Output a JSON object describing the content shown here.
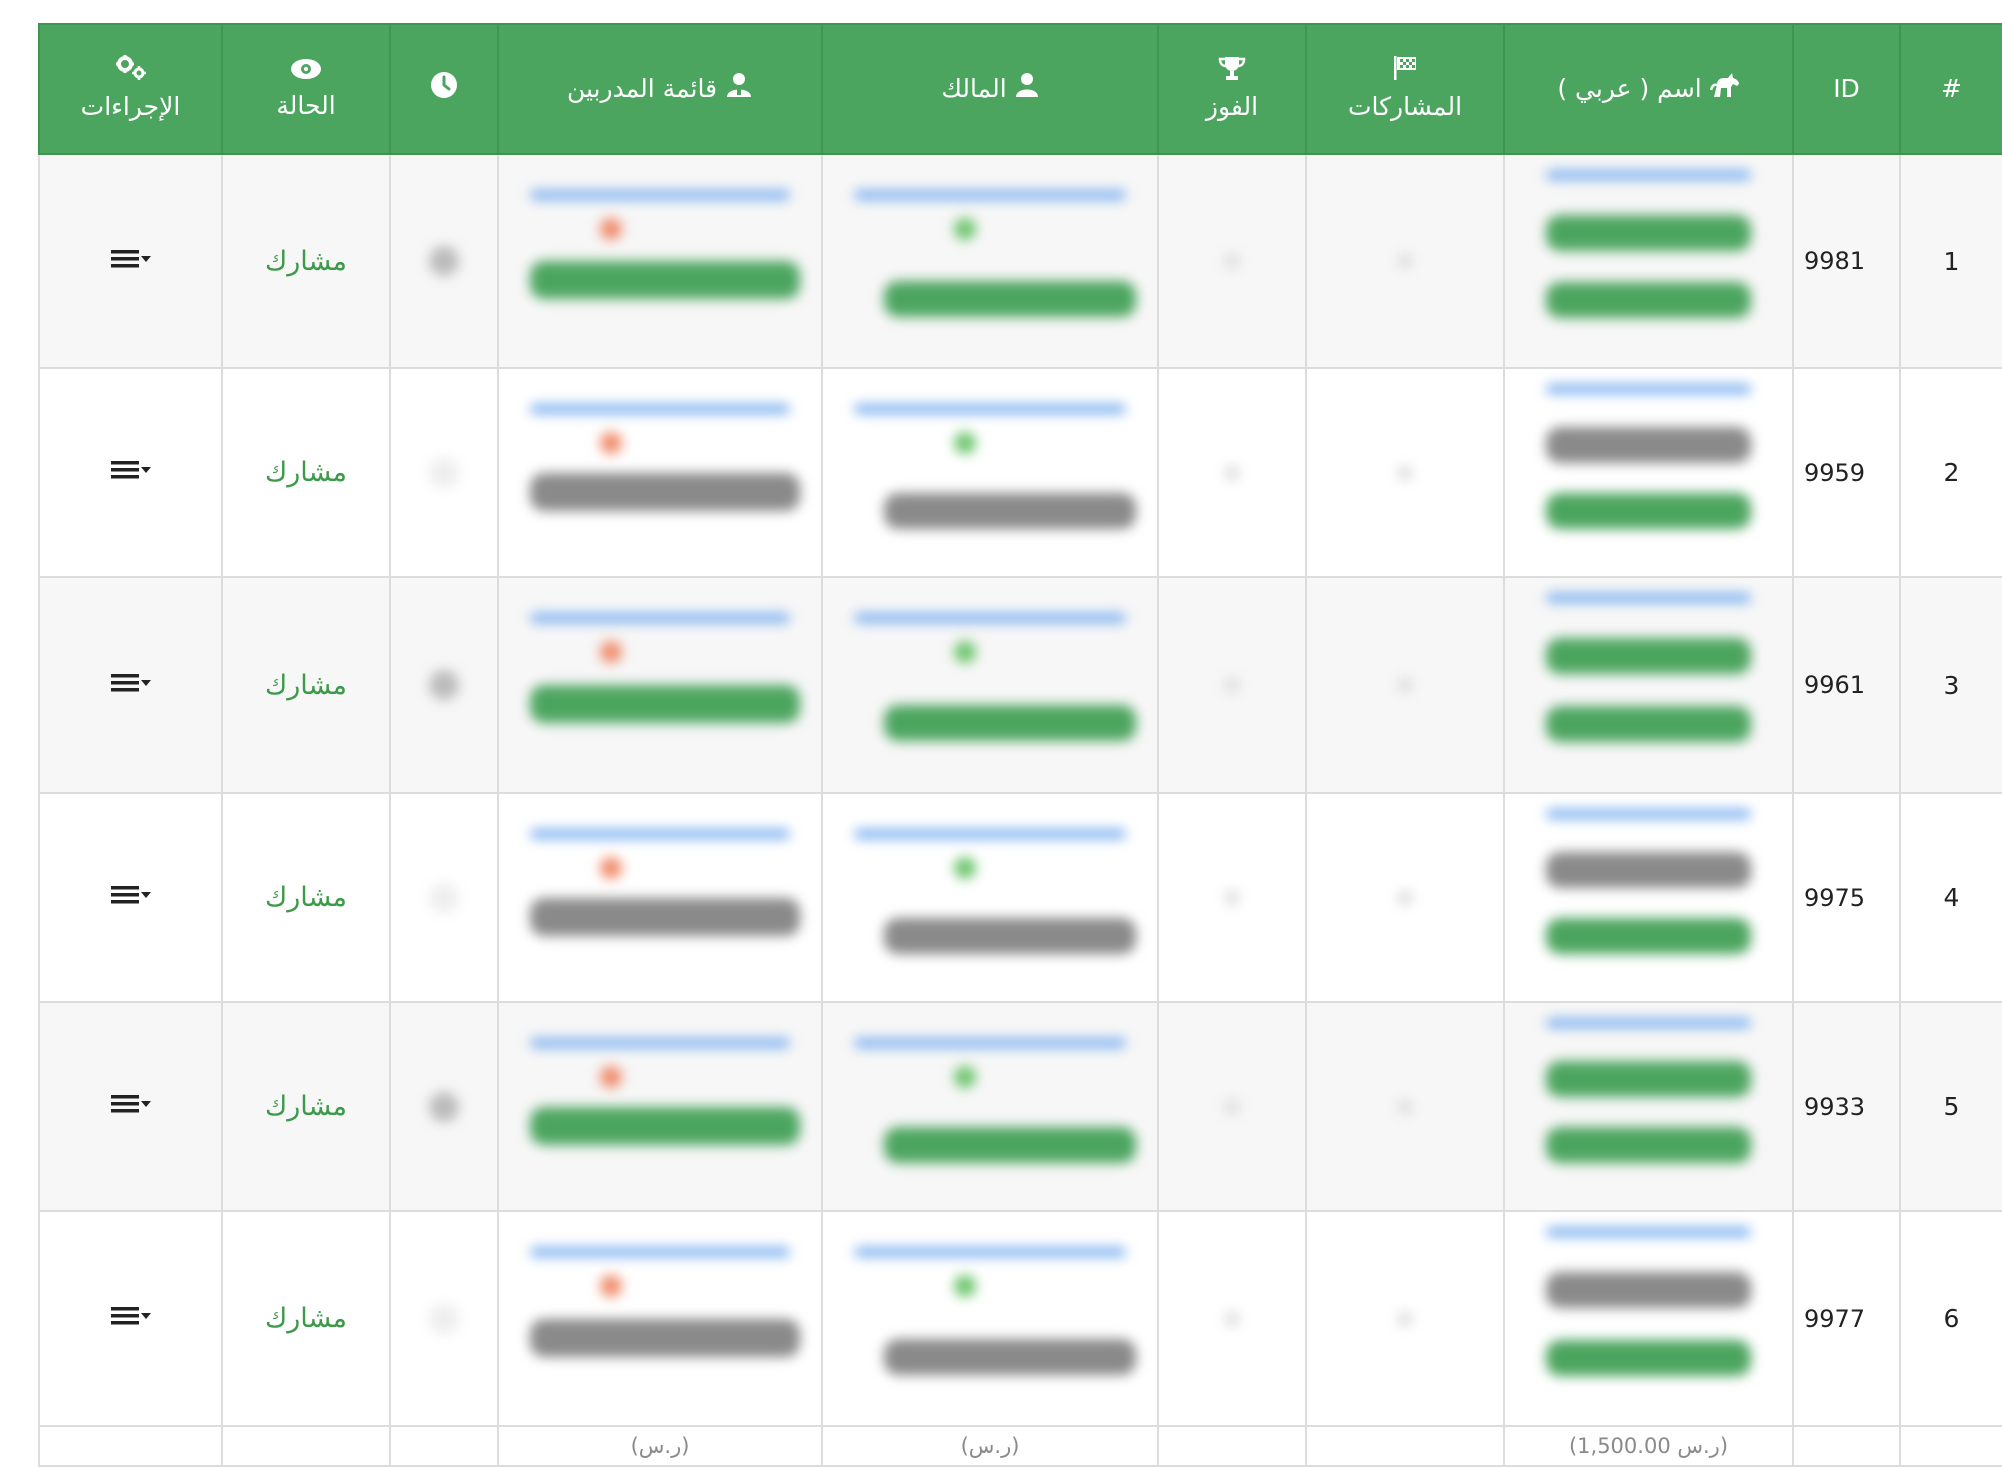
{
  "table": {
    "headers": {
      "num": "#",
      "id": "ID",
      "name": "اسم ( عربي )",
      "entries": "المشاركات",
      "wins": "الفوز",
      "owner": "المالك",
      "trainers": "قائمة المدربين",
      "time": "",
      "status": "الحالة",
      "actions": "الإجراءات"
    },
    "header_icons": {
      "name": "horse-icon",
      "entries": "checkered-flag-icon",
      "wins": "trophy-icon",
      "owner": "user-icon",
      "trainers": "users-icon",
      "time": "clock-icon",
      "status": "eye-icon",
      "actions": "gears-icon"
    },
    "rows": [
      {
        "num": "1",
        "id": "9981",
        "status": "مشارك"
      },
      {
        "num": "2",
        "id": "9959",
        "status": "مشارك"
      },
      {
        "num": "3",
        "id": "9961",
        "status": "مشارك"
      },
      {
        "num": "4",
        "id": "9975",
        "status": "مشارك"
      },
      {
        "num": "5",
        "id": "9933",
        "status": "مشارك"
      },
      {
        "num": "6",
        "id": "9977",
        "status": "مشارك"
      }
    ],
    "footer": {
      "name_price": "(1,500.00 ر.س)",
      "owner_price": "(ر.س)",
      "trainers_price": "(ر.س)"
    }
  },
  "colors": {
    "header_bg": "#4ca55f",
    "status_text": "#3c9a4a",
    "badge_green": "#4ca55f",
    "badge_gray": "#8a8a8a",
    "link_blue": "#7fb2f0"
  }
}
